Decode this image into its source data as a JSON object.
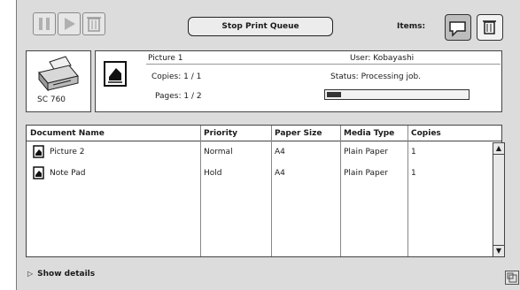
{
  "toolbar": {
    "pause_icon": "pause-icon",
    "resume_icon": "play-icon",
    "delete_icon": "trash-icon",
    "stop_queue_label": "Stop Print Queue",
    "items_label": "Items:"
  },
  "printer": {
    "name": "SC 760"
  },
  "current_job": {
    "name": "Picture 1",
    "user": "User: Kobayashi",
    "copies": "Copies: 1 / 1",
    "status": "Status: Processing job.",
    "pages": "Pages: 1 / 2",
    "progress_fraction": 0.1
  },
  "queue": {
    "columns": [
      "Document Name",
      "Priority",
      "Paper Size",
      "Media Type",
      "Copies"
    ],
    "rows": [
      {
        "name": "Picture 2",
        "priority": "Normal",
        "paper": "A4",
        "media": "Plain Paper",
        "copies": "1"
      },
      {
        "name": "Note Pad",
        "priority": "Hold",
        "paper": "A4",
        "media": "Plain Paper",
        "copies": "1"
      }
    ]
  },
  "footer": {
    "show_details": "Show details"
  }
}
